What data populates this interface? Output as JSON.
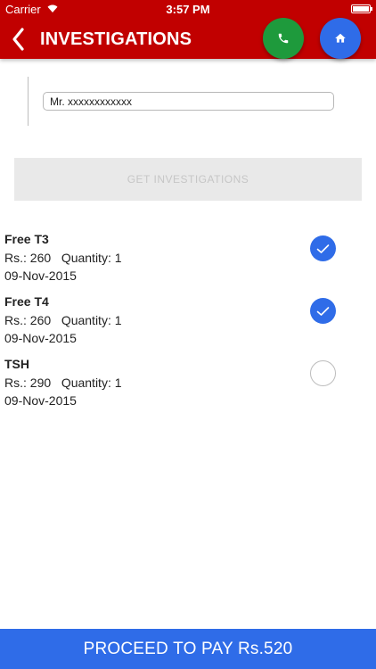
{
  "status_bar": {
    "carrier": "Carrier",
    "time": "3:57 PM"
  },
  "header": {
    "title": "INVESTIGATIONS",
    "colors": {
      "header_bg": "#c10000",
      "call_btn": "#1e9a3c",
      "home_btn": "#2f6ce8"
    },
    "icons": {
      "back": "chevron-left-icon",
      "call": "phone-icon",
      "home": "home-icon"
    }
  },
  "patient": {
    "value": "Mr. xxxxxxxxxxxx"
  },
  "get_button": {
    "label": "GET INVESTIGATIONS"
  },
  "tests": [
    {
      "name": "Free T3",
      "price": "Rs.: 260",
      "quantity": "Quantity: 1",
      "date": "09-Nov-2015",
      "selected": true
    },
    {
      "name": "Free T4",
      "price": "Rs.: 260",
      "quantity": "Quantity: 1",
      "date": "09-Nov-2015",
      "selected": true
    },
    {
      "name": "TSH",
      "price": "Rs.: 290",
      "quantity": "Quantity: 1",
      "date": "09-Nov-2015",
      "selected": false
    }
  ],
  "proceed_button": {
    "label": "PROCEED TO PAY Rs.520",
    "color": "#2f6ce8"
  }
}
